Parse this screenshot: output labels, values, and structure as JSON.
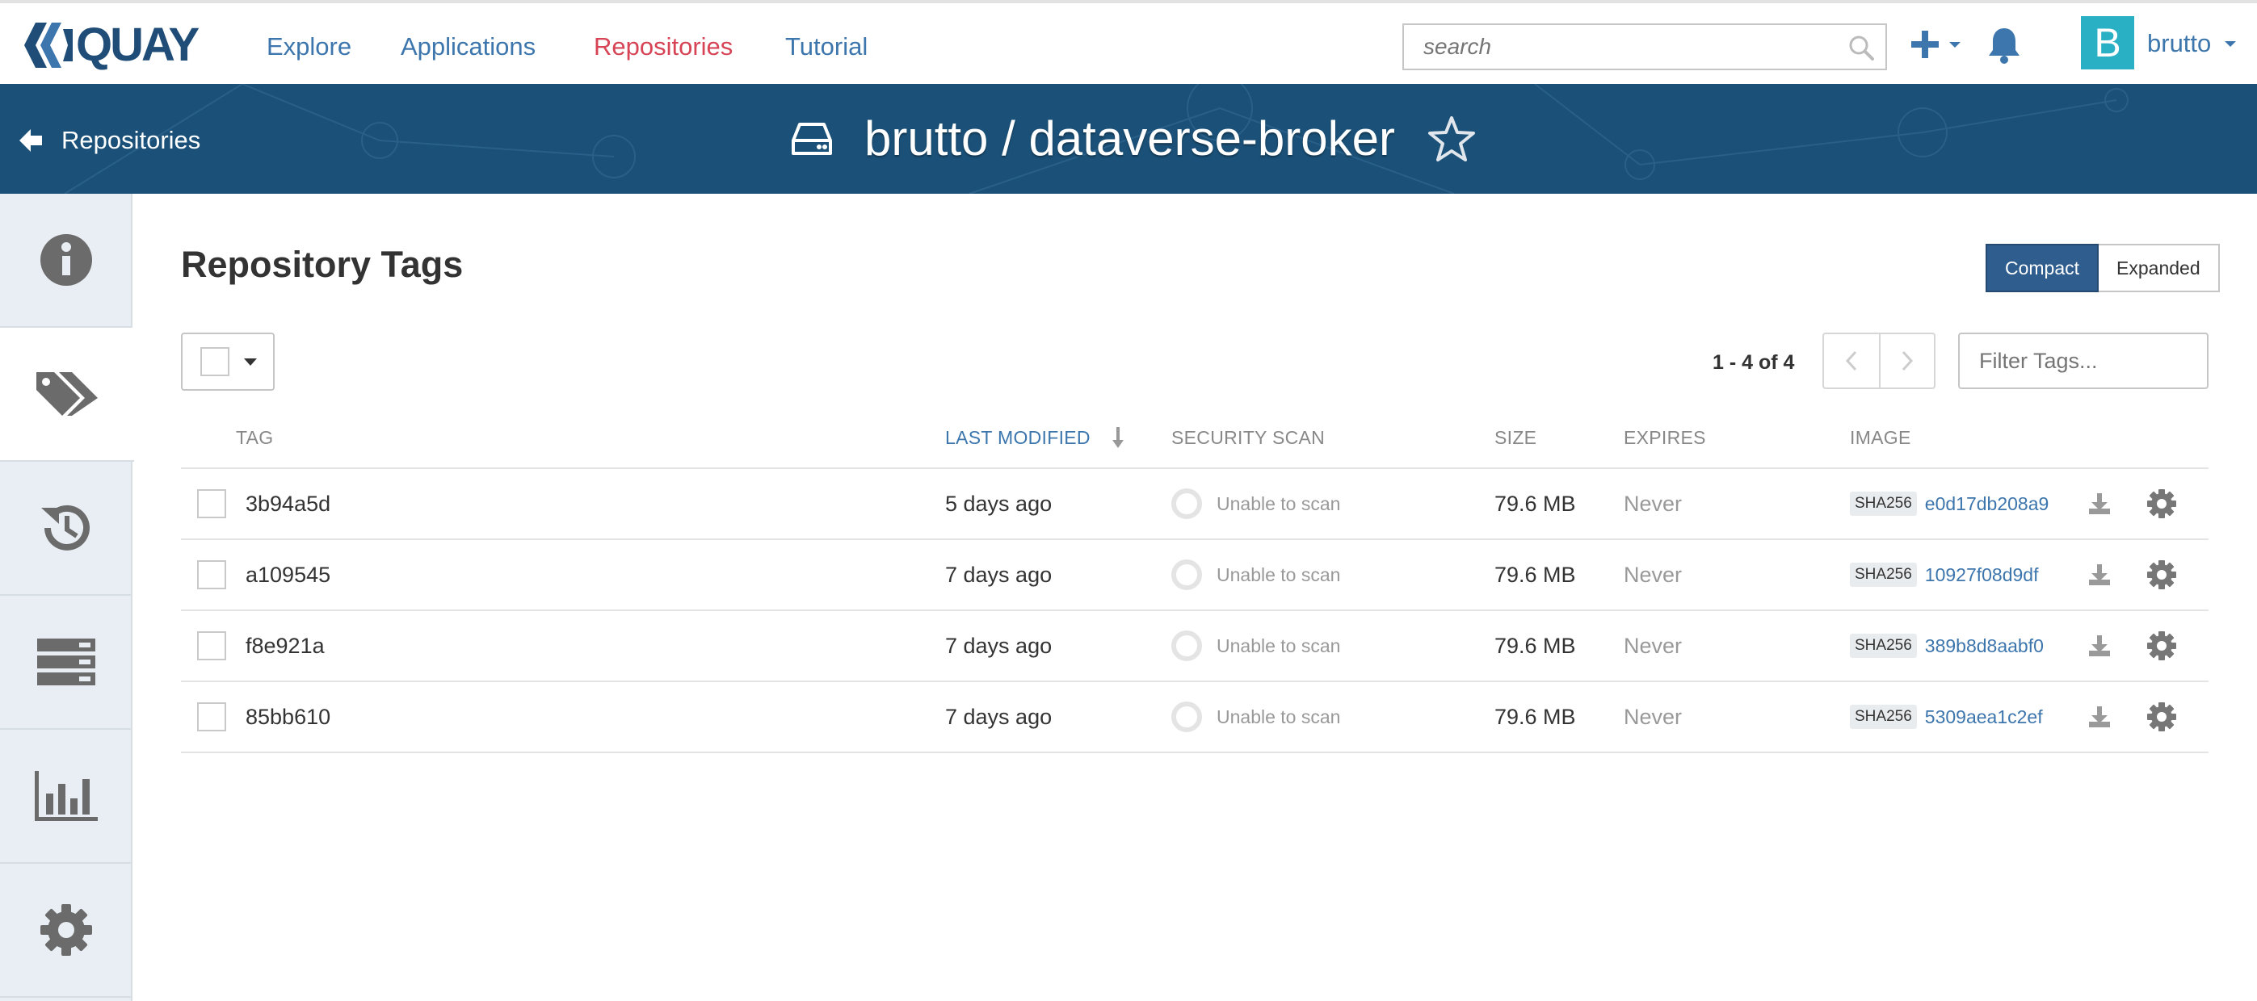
{
  "brand": {
    "logo_text": "QUAY"
  },
  "nav": {
    "links": [
      "Explore",
      "Applications",
      "Repositories",
      "Tutorial"
    ],
    "active": "Repositories"
  },
  "search": {
    "placeholder": "search"
  },
  "user": {
    "avatar_letter": "B",
    "name": "brutto"
  },
  "repo_header": {
    "back_label": "Repositories",
    "title": "brutto / dataverse-broker"
  },
  "sidebar": {
    "items": [
      "info-icon",
      "tags-icon",
      "history-icon",
      "builds-icon",
      "usage-logs-icon",
      "settings-icon"
    ],
    "active_index": 1
  },
  "main": {
    "heading": "Repository Tags",
    "view_toggle": {
      "compact": "Compact",
      "expanded": "Expanded",
      "selected": "Compact"
    },
    "pagination": {
      "label": "1 - 4 of 4"
    },
    "filter": {
      "placeholder": "Filter Tags..."
    }
  },
  "table": {
    "columns": {
      "tag": "TAG",
      "last_modified": "LAST MODIFIED",
      "security_scan": "SECURITY SCAN",
      "size": "SIZE",
      "expires": "EXPIRES",
      "image": "IMAGE"
    },
    "rows": [
      {
        "tag": "3b94a5d",
        "last_modified": "5 days ago",
        "scan": "Unable to scan",
        "size": "79.6 MB",
        "expires": "Never",
        "sha_label": "SHA256",
        "digest": "e0d17db208a9"
      },
      {
        "tag": "a109545",
        "last_modified": "7 days ago",
        "scan": "Unable to scan",
        "size": "79.6 MB",
        "expires": "Never",
        "sha_label": "SHA256",
        "digest": "10927f08d9df"
      },
      {
        "tag": "f8e921a",
        "last_modified": "7 days ago",
        "scan": "Unable to scan",
        "size": "79.6 MB",
        "expires": "Never",
        "sha_label": "SHA256",
        "digest": "389b8d8aabf0"
      },
      {
        "tag": "85bb610",
        "last_modified": "7 days ago",
        "scan": "Unable to scan",
        "size": "79.6 MB",
        "expires": "Never",
        "sha_label": "SHA256",
        "digest": "5309aea1c2ef"
      }
    ]
  },
  "colors": {
    "brand_blue": "#1f4d77",
    "link_blue": "#3c76ad",
    "active_red": "#d64456",
    "header_band": "#1b5178",
    "toggle_active": "#2f5d8d",
    "avatar_teal": "#2ab0c4"
  }
}
